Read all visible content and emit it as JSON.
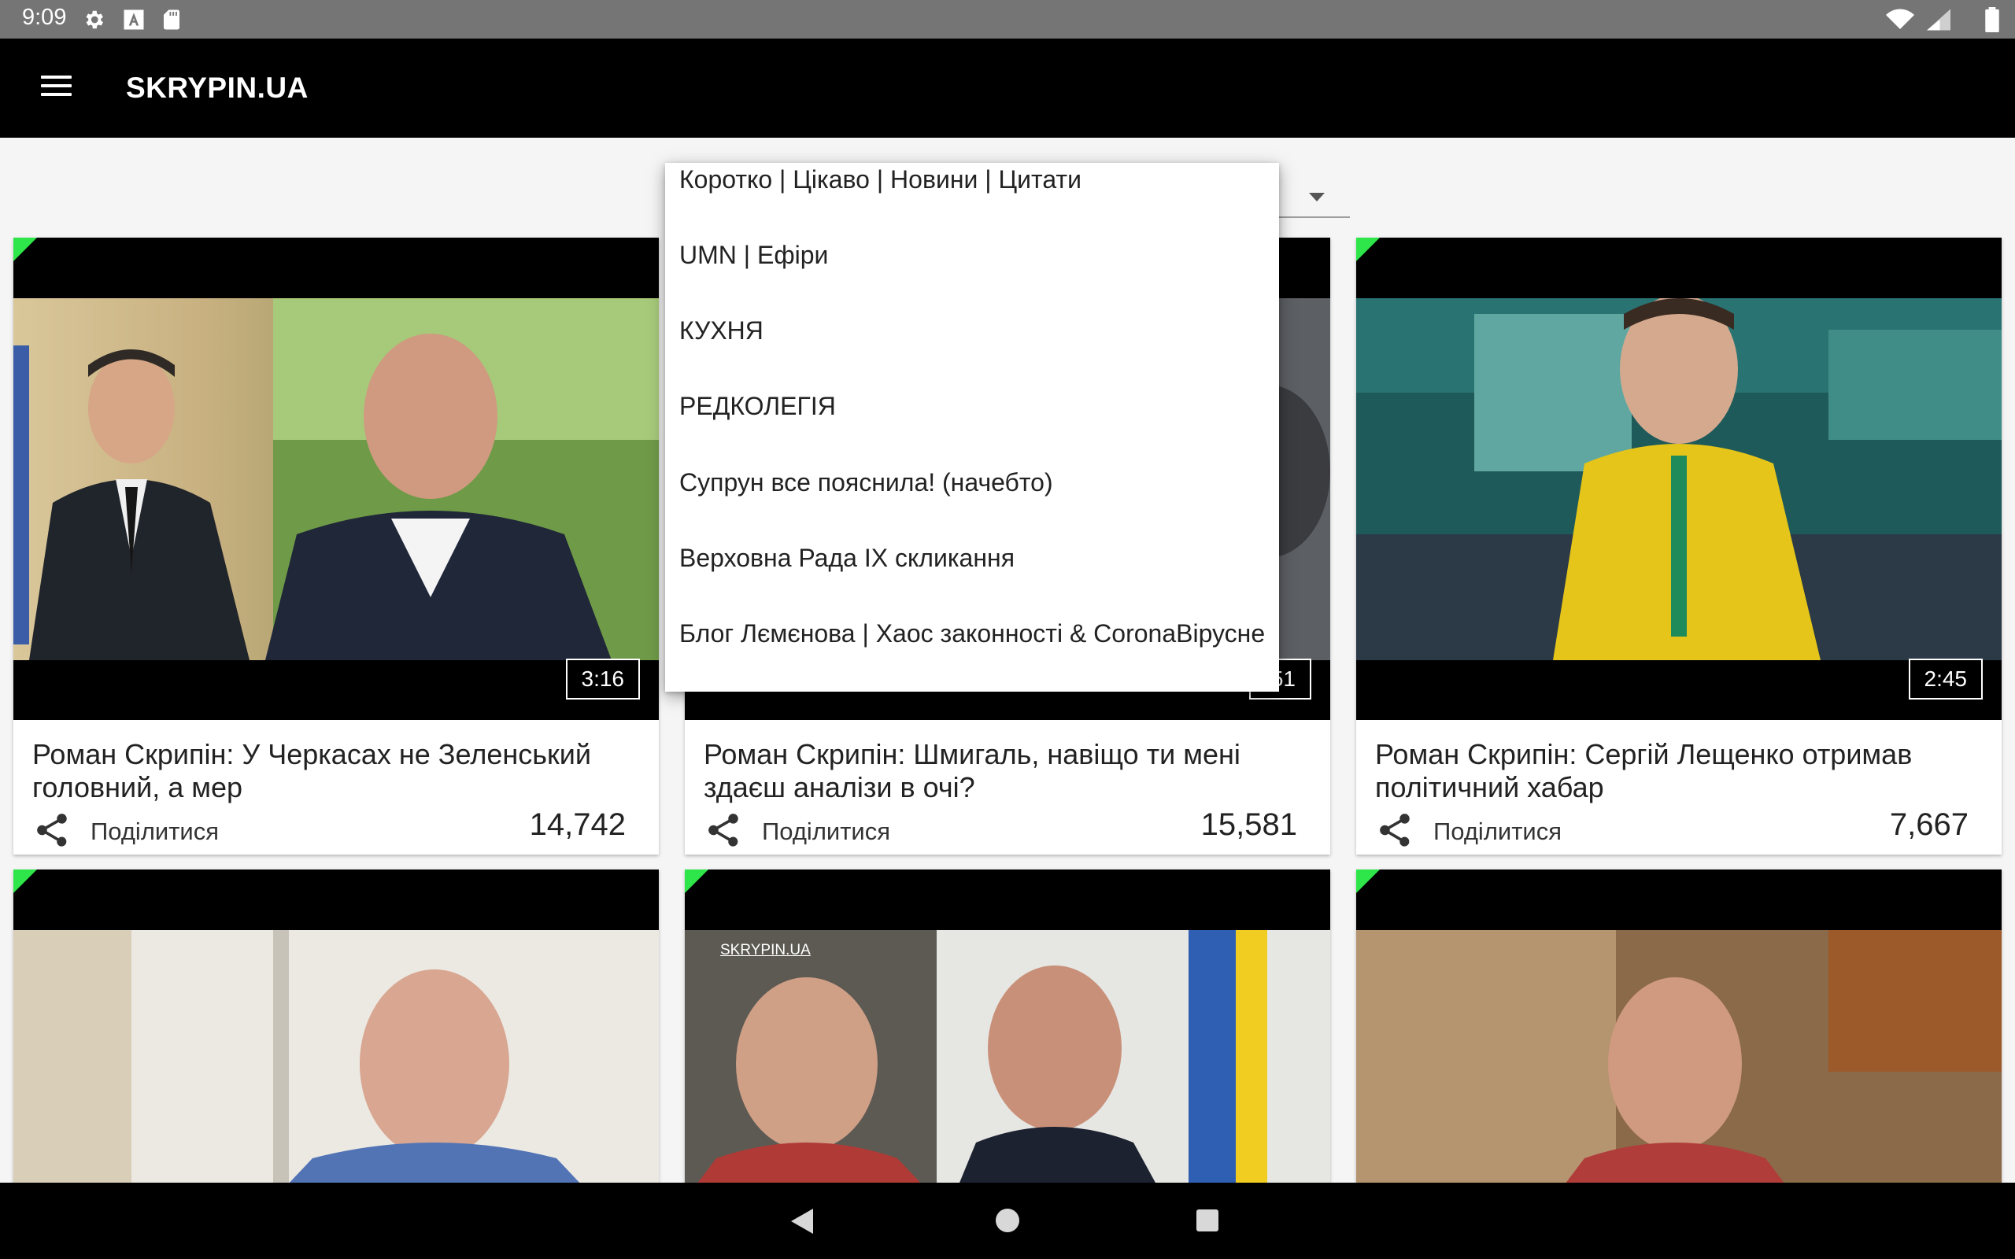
{
  "status_bar": {
    "time": "9:09",
    "left_icons": [
      "settings-icon",
      "keyboard-a-icon",
      "sd-card-icon"
    ],
    "right_icons": [
      "wifi-icon",
      "signal-icon",
      "battery-icon"
    ]
  },
  "app_bar": {
    "menu_icon": "hamburger-menu-icon",
    "title": "SKRYPIN.UA"
  },
  "dropdown": {
    "items": [
      "Коротко | Цікаво | Новини | Цитати",
      "UMN | Ефіри",
      "КУХНЯ",
      "РЕДКОЛЕГІЯ",
      "Супрун все пояснила! (начебто)",
      "Верховна Рада IX скликання",
      "Блог Лємєнова | Хаос законності & CoronaВірусне"
    ]
  },
  "videos": [
    {
      "title": "Роман Скрипін: У Черкасах не Зеленський головний, а мер",
      "duration": "3:16",
      "share_label": "Поділитися",
      "views": "14,742"
    },
    {
      "title": "Роман Скрипін: Шмигаль, навіщо ти мені здаєш аналізи в очі?",
      "duration": ":51",
      "share_label": "Поділитися",
      "views": "15,581"
    },
    {
      "title": "Роман Скрипін: Сергій Лещенко отримав політичний хабар",
      "duration": "2:45",
      "share_label": "Поділитися",
      "views": "7,667"
    },
    {
      "watermark": "SKRYPIN.UA"
    }
  ],
  "colors": {
    "app_bar": "#000000",
    "status_bar": "#757575",
    "accent_corner": "#2ee64a",
    "background": "#f5f5f5"
  }
}
